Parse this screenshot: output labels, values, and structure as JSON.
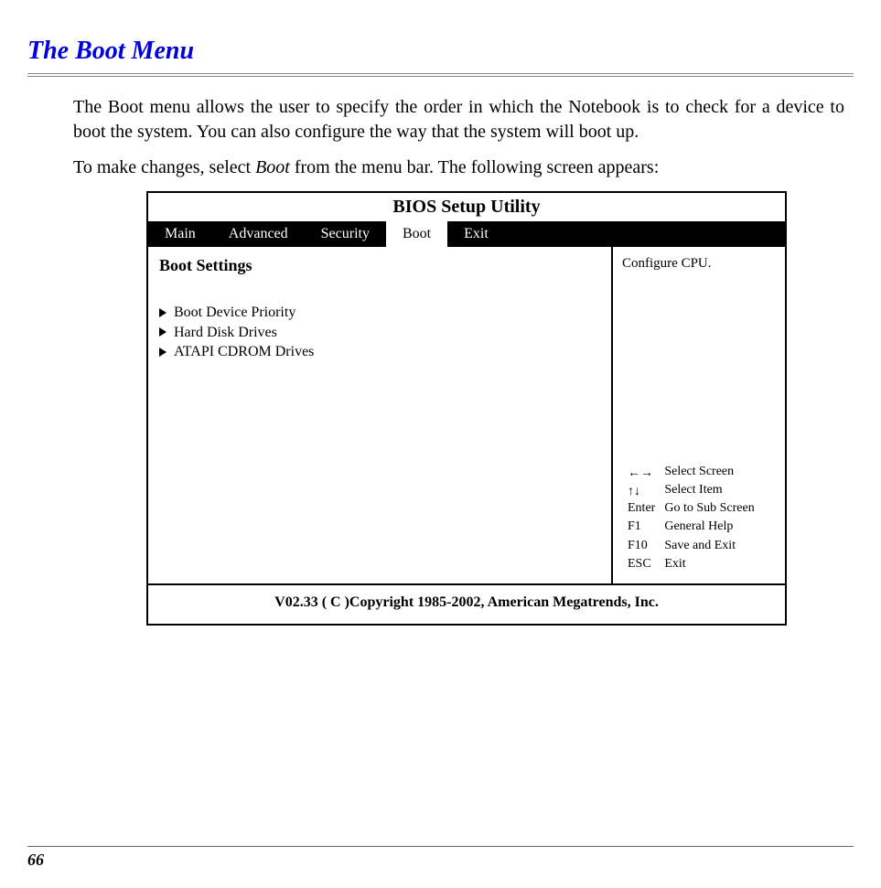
{
  "section_title": "The Boot Menu",
  "para1_a": "The Boot menu allows the user to specify the order in which the Notebook is to check for a device to boot the system.  You can also configure the way that the system will boot up.",
  "para2_a": "To make changes, select ",
  "para2_italic": "Boot",
  "para2_b": " from the menu bar.  The following screen appears:",
  "bios": {
    "title": "BIOS Setup Utility",
    "tabs": [
      "Main",
      "Advanced",
      "Security",
      "Boot",
      "Exit"
    ],
    "active_tab_index": 3,
    "left": {
      "heading": "Boot Settings",
      "items": [
        "Boot Device Priority",
        "Hard Disk Drives",
        "ATAPI CDROM Drives"
      ]
    },
    "right": {
      "help_text": "Configure CPU.",
      "legend": [
        {
          "key_glyph": "↔",
          "label": "Select Screen"
        },
        {
          "key_glyph": "↕",
          "label": "Select Item"
        },
        {
          "key_glyph": "Enter",
          "label": "Go to Sub Screen"
        },
        {
          "key_glyph": "F1",
          "label": "General Help"
        },
        {
          "key_glyph": "F10",
          "label": "Save and Exit"
        },
        {
          "key_glyph": "ESC",
          "label": "Exit"
        }
      ]
    },
    "footer": "V02.33 ( C )Copyright 1985-2002, American Megatrends, Inc."
  },
  "page_number": "66"
}
